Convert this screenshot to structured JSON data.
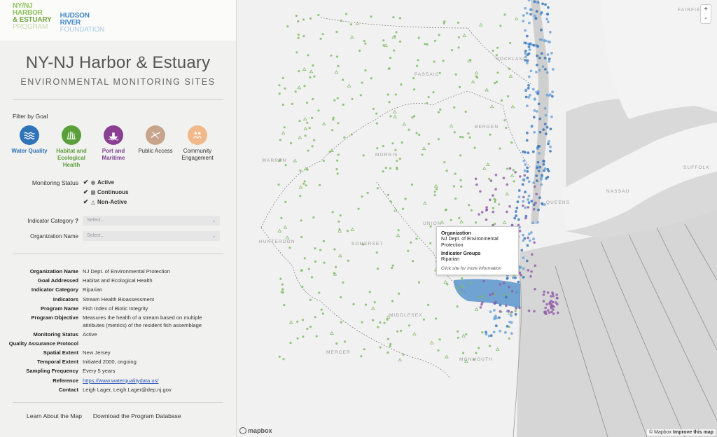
{
  "logos": {
    "harbor": [
      "NY/NJ",
      "HARBOR",
      "& ESTUARY",
      "PROGRAM"
    ],
    "hudson": [
      "HUDSON",
      "RIVER",
      "FOUNDATION"
    ]
  },
  "header": {
    "title": "NY-NJ Harbor & Estuary",
    "subtitle": "ENVIRONMENTAL MONITORING SITES"
  },
  "filter": {
    "label": "Filter by Goal",
    "goals": [
      {
        "label": "Water Quality",
        "icon": "waves-icon",
        "color": "#2f73b8"
      },
      {
        "label": "Habitat and Ecological Health",
        "icon": "grass-icon",
        "color": "#5aa03a"
      },
      {
        "label": "Port and Maritime",
        "icon": "ship-icon",
        "color": "#8a3f93"
      },
      {
        "label": "Public Access",
        "icon": "kayak-icon",
        "color": "#c8a48c"
      },
      {
        "label": "Community Engagement",
        "icon": "people-icon",
        "color": "#f1b88a"
      }
    ]
  },
  "status": {
    "label": "Monitoring Status",
    "options": [
      {
        "label": "Active",
        "checked": "✔"
      },
      {
        "label": "Continuous",
        "checked": "✔"
      },
      {
        "label": "Non-Active",
        "checked": "✔"
      }
    ]
  },
  "selects": {
    "indicator_label": "Indicator Category",
    "indicator_help": "?",
    "indicator_placeholder": "Select...",
    "org_label": "Organization Name",
    "org_placeholder": "Select..."
  },
  "info": {
    "rows": [
      {
        "key": "Organization Name",
        "value": "NJ Dept. of Environmental Protection"
      },
      {
        "key": "Goal Addressed",
        "value": "Habitat and Ecological Health"
      },
      {
        "key": "Indicator Category",
        "value": "Riparian"
      },
      {
        "key": "Indicators",
        "value": "Stream Health Bioassessment"
      },
      {
        "key": "Program Name",
        "value": "Fish Index of Biotic Integrity"
      },
      {
        "key": "Program Objective",
        "value": "Measures the health of a stream based on multiple attributes (metrics) of the resident fish assemblage"
      },
      {
        "key": "Monitoring Status",
        "value": "Active"
      },
      {
        "key": "Quality Assurance Protocol",
        "value": ""
      },
      {
        "key": "Spatial Extent",
        "value": "New Jersey"
      },
      {
        "key": "Temporal Extent",
        "value": "Initiated 2000, ongoing"
      },
      {
        "key": "Sampling Frequency",
        "value": "Every 5 years"
      },
      {
        "key": "Reference",
        "value": "https://www.waterqualitydata.us/"
      },
      {
        "key": "Contact",
        "value": "Leigh Lager, Leigh.Lager@dep.nj.gov"
      }
    ]
  },
  "footer": {
    "learn": "Learn About the Map",
    "download": "Download the Program Database"
  },
  "map": {
    "labels": {
      "fairfield": "FAIRFIELD",
      "rockland": "ROCKLAND",
      "passaic": "PASSAIC",
      "warren": "WARREN",
      "morris": "MORRIS",
      "suffolk": "SUFFOLK",
      "nassau": "NASSAU",
      "queens": "QUEENS",
      "hunterdon": "HUNTERDON",
      "union": "UNION",
      "somerset": "SOMERSET",
      "middlesex": "MIDDLESEX",
      "mercer": "MERCER",
      "monmouth": "MONMOUTH",
      "bergen": "BERGEN"
    },
    "zoom_in": "+",
    "zoom_out": "-",
    "mapbox_logo": "mapbox",
    "attribution_copy": "© Mapbox",
    "attribution_improve": "Improve this map",
    "colors": {
      "water": "#d4d4d4",
      "land": "#f1f1f1",
      "blue": "#2f73b8",
      "green": "#7bbb5e",
      "purple": "#8e5aa6",
      "lightblue": "#6aa3d8"
    }
  },
  "popup": {
    "org_heading": "Organization",
    "org_value": "NJ Dept. of Environmental Protection",
    "ind_heading": "Indicator Groups",
    "ind_value": "Riparian",
    "hint": "Click site for more information"
  }
}
